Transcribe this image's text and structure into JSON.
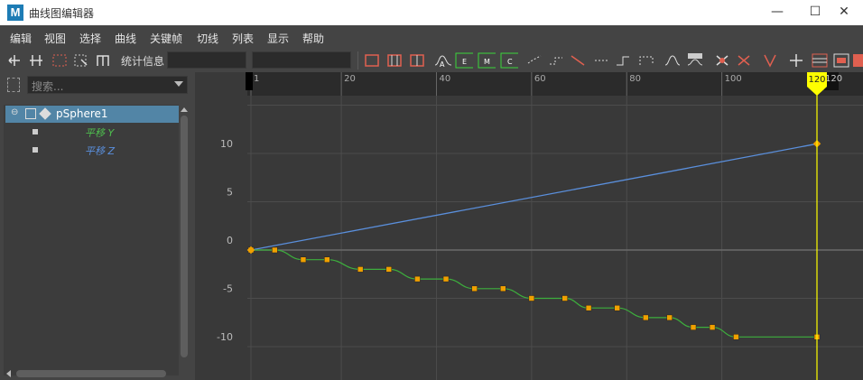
{
  "window": {
    "app_icon": "M",
    "title": "曲线图编辑器",
    "minimize_glyph": "—",
    "maximize_glyph": "☐",
    "close_glyph": "✕"
  },
  "menu": [
    "编辑",
    "视图",
    "选择",
    "曲线",
    "关键帧",
    "切线",
    "列表",
    "显示",
    "帮助"
  ],
  "toolbar": {
    "stats_label": "统计信息",
    "frame_field": "",
    "value_field": "",
    "tangent_buttons": [
      "A",
      "E",
      "M",
      "C"
    ]
  },
  "outliner": {
    "search_placeholder": "搜索...",
    "object": {
      "name": "pSphere1",
      "expander": "⊖"
    },
    "attributes": [
      {
        "label": "平移 Y",
        "color": "#4fbf4f"
      },
      {
        "label": "平移 Z",
        "color": "#5a8fdc"
      }
    ]
  },
  "graph": {
    "time_ticks": [
      "1",
      "20",
      "40",
      "60",
      "80",
      "100",
      "120"
    ],
    "current_time_label": "120",
    "end_frame_label": "120",
    "value_ticks": [
      "10",
      "5",
      "0",
      "-5",
      "-10"
    ],
    "playhead_color": "#ffff00",
    "key_color": "#f0a000",
    "curves": {
      "translate_z": {
        "color": "#5a8fdc",
        "keys": [
          [
            1,
            0
          ],
          [
            120,
            11
          ]
        ]
      },
      "translate_y": {
        "color": "#3daf3d",
        "keys": [
          [
            1,
            0
          ],
          [
            6,
            0
          ],
          [
            12,
            -1
          ],
          [
            17,
            -1
          ],
          [
            24,
            -2
          ],
          [
            30,
            -2
          ],
          [
            36,
            -3
          ],
          [
            42,
            -3
          ],
          [
            48,
            -4
          ],
          [
            54,
            -4
          ],
          [
            60,
            -5
          ],
          [
            67,
            -5
          ],
          [
            72,
            -6
          ],
          [
            78,
            -6
          ],
          [
            84,
            -7
          ],
          [
            89,
            -7
          ],
          [
            94,
            -8
          ],
          [
            98,
            -8
          ],
          [
            103,
            -9
          ],
          [
            120,
            -9
          ]
        ]
      }
    }
  }
}
